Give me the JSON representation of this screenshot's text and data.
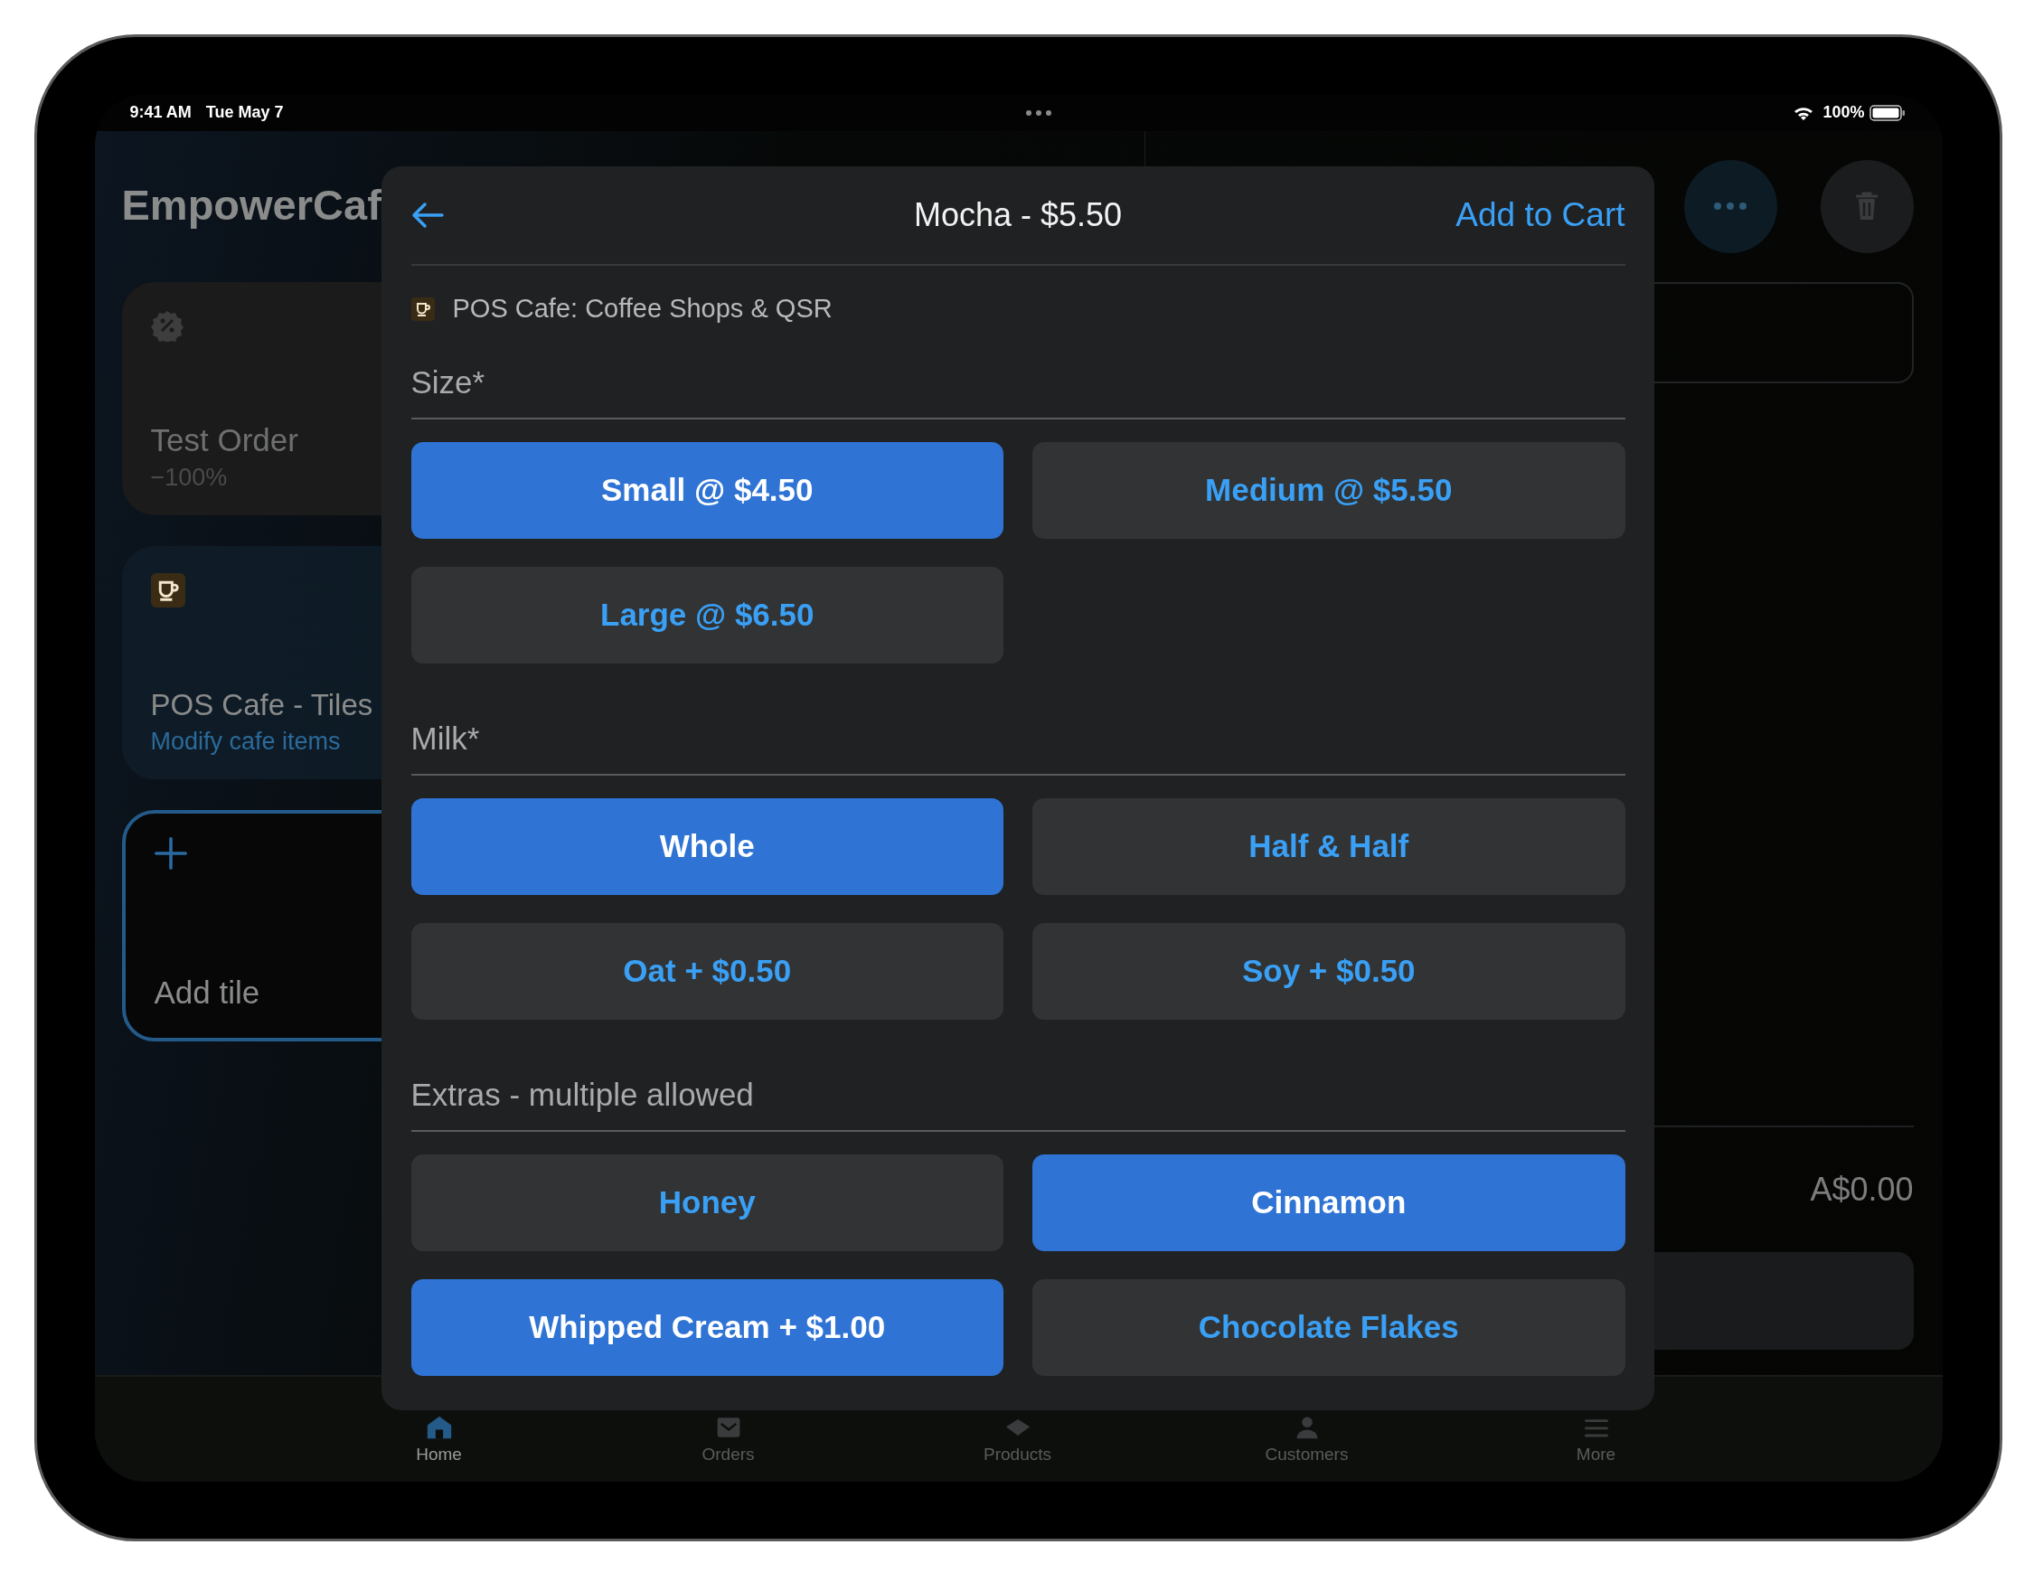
{
  "status_bar": {
    "time": "9:41 AM",
    "date": "Tue May 7",
    "battery": "100%"
  },
  "app": {
    "title": "EmpowerCaf",
    "tiles": [
      {
        "kind": "discount",
        "title": "Test Order",
        "subtitle": "−100%"
      },
      {
        "kind": "category",
        "title": "POS Cafe - Tiles",
        "subtitle": "Modify cafe items"
      },
      {
        "kind": "add",
        "title": "Add tile"
      }
    ]
  },
  "cart": {
    "total": "A$0.00"
  },
  "tab_bar": [
    {
      "label": "Home",
      "kind": "home",
      "selected": true
    },
    {
      "label": "Orders",
      "kind": "orders",
      "selected": false
    },
    {
      "label": "Products",
      "kind": "products",
      "selected": false
    },
    {
      "label": "Customers",
      "kind": "customers",
      "selected": false
    },
    {
      "label": "More",
      "kind": "more",
      "selected": false
    }
  ],
  "modal": {
    "title": "Mocha - $5.50",
    "action": "Add to Cart",
    "source": "POS Cafe: Coffee Shops & QSR",
    "groups": [
      {
        "title": "Size*",
        "options": [
          {
            "label": "Small @ $4.50",
            "selected": true
          },
          {
            "label": "Medium @ $5.50",
            "selected": false
          },
          {
            "label": "Large @ $6.50",
            "selected": false
          }
        ]
      },
      {
        "title": "Milk*",
        "options": [
          {
            "label": "Whole",
            "selected": true
          },
          {
            "label": "Half & Half",
            "selected": false
          },
          {
            "label": "Oat + $0.50",
            "selected": false
          },
          {
            "label": "Soy + $0.50",
            "selected": false
          }
        ]
      },
      {
        "title": "Extras - multiple allowed",
        "options": [
          {
            "label": "Honey",
            "selected": false
          },
          {
            "label": "Cinnamon",
            "selected": true
          },
          {
            "label": "Whipped Cream + $1.00",
            "selected": true
          },
          {
            "label": "Chocolate Flakes",
            "selected": false
          }
        ]
      }
    ]
  }
}
